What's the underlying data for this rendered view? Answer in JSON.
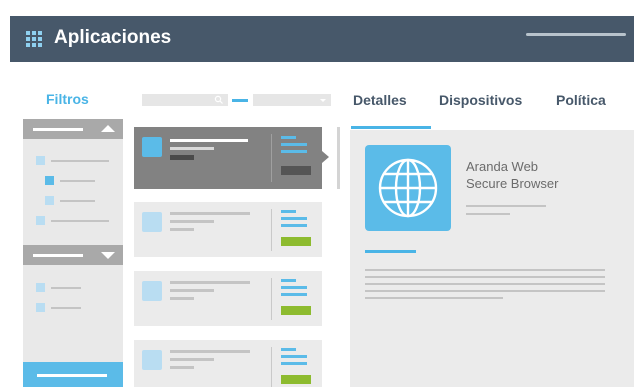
{
  "header": {
    "title": "Aplicaciones",
    "app_icon": "grid-icon",
    "background": "#47586a"
  },
  "filters": {
    "label": "Filtros",
    "accent": "#49b4e6"
  },
  "search": {
    "icon": "search-icon"
  },
  "tabs": [
    {
      "label": "Detalles",
      "active": true
    },
    {
      "label": "Dispositivos",
      "active": false
    },
    {
      "label": "Política",
      "active": false
    }
  ],
  "app_list": {
    "count_visible": 4,
    "selected_index": 0,
    "status_colors": {
      "ok": "#8dbb2f",
      "selected": "#555555"
    }
  },
  "detail": {
    "app_name_line1": "Aranda Web",
    "app_name_line2": "Secure Browser",
    "app_icon": "globe-icon"
  }
}
